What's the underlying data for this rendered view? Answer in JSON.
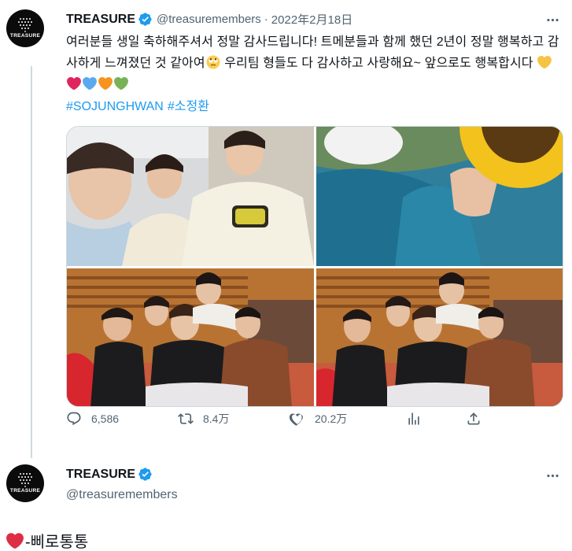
{
  "tweet1": {
    "author_name": "TREASURE",
    "handle": "@treasuremembers",
    "separator": "·",
    "date": "2022年2月18日",
    "text_part1": "여러분들 생일 축하해주셔서 정말 감사드립니다! 트메분들과 함께 했던 2년이 정말 행복하고 감사하게 느껴졌던 것 같아여",
    "text_part2": " 우리팀 형들도 다 감사하고 사랑해요~ 앞으로도 행복합시다 ",
    "hashtags": [
      "#SOJUNGHWAN",
      "#소정환"
    ],
    "heart_colors": [
      "#f5c542",
      "#e0245e",
      "#5aa9f0",
      "#f7931e",
      "#77b255"
    ],
    "avatar_logo_text": "TREASURE",
    "stats": {
      "replies": "6,586",
      "retweets": "8.4万",
      "likes": "20.2万"
    }
  },
  "tweet2": {
    "author_name": "TREASURE",
    "handle": "@treasuremembers",
    "avatar_logo_text": "TREASURE"
  },
  "reply_text": "-삐로통통",
  "colors": {
    "link": "#1d9bf0",
    "verified": "#1d9bf0",
    "muted": "#536471"
  },
  "icons": [
    "verified-badge-icon",
    "more-icon",
    "reply-icon",
    "retweet-icon",
    "like-icon",
    "stats-icon",
    "share-icon",
    "heart-emoji-icon"
  ]
}
